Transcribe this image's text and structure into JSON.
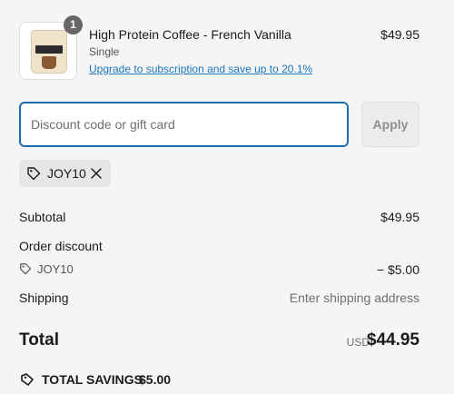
{
  "product": {
    "quantity": "1",
    "name": "High Protein Coffee - French Vanilla",
    "variant": "Single",
    "upgrade_link": "Upgrade to subscription and save up to 20.1%",
    "price": "$49.95",
    "thumbnail_icon": "coffee-pouch-icon"
  },
  "discount": {
    "placeholder": "Discount code or gift card",
    "value": "",
    "apply_label": "Apply",
    "applied_code": "JOY10"
  },
  "summary": {
    "subtotal_label": "Subtotal",
    "subtotal_value": "$49.95",
    "order_discount_label": "Order discount",
    "discount_code": "JOY10",
    "discount_value": "− $5.00",
    "shipping_label": "Shipping",
    "shipping_value": "Enter shipping address",
    "total_label": "Total",
    "currency": "USD",
    "total_value": "$44.95"
  },
  "savings": {
    "label": "TOTAL SAVINGS",
    "value": "$5.00"
  },
  "colors": {
    "accent": "#1c6cb5",
    "link": "#1c75bc",
    "badge": "#666666",
    "background": "#f5f5f5"
  }
}
